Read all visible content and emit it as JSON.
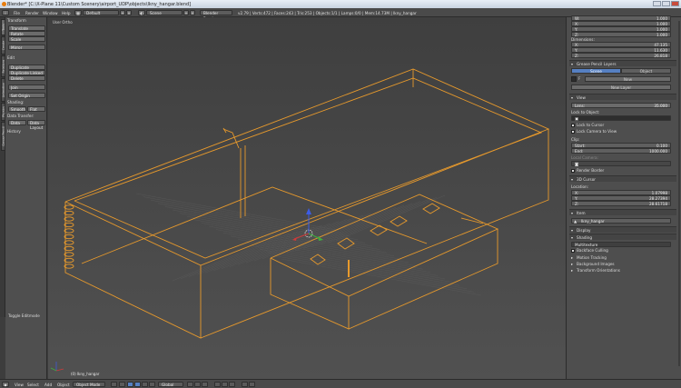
{
  "window": {
    "title": "Blender* [C:\\X-Plane 11\\Custom Scenery\\airport_UDP\\objects\\lkny_hangar.blend]"
  },
  "header": {
    "menu": [
      "File",
      "Render",
      "Window",
      "Help"
    ],
    "layout": "Default",
    "scene": "Scene",
    "engine": "Blender Render",
    "stats": "v2.79 | Verts:472 | Faces:243 | Tris:253 | Objects:1/1 | Lamps:0/0 | Mem:14.73M | lkny_hangar"
  },
  "toolshelf": {
    "tabs": [
      "Tools",
      "Create",
      "Relations",
      "Animation",
      "Physics",
      "Grease Pencil"
    ],
    "transform_title": "Transform",
    "transform_buttons": [
      "Translate",
      "Rotate",
      "Scale",
      "Mirror"
    ],
    "edit_title": "Edit",
    "edit_buttons": [
      "Duplicate",
      "Duplicate Linked",
      "Delete"
    ],
    "join": "Join",
    "set_origin": "Set Origin",
    "shading_title": "Shading:",
    "smooth": "Smooth",
    "flat": "Flat",
    "data_transfer_title": "Data Transfer:",
    "data": "Data",
    "data_layout": "Data Layout",
    "history_title": "History",
    "toggle_edit": "Toggle Editmode"
  },
  "viewport": {
    "view_label": "User Ortho",
    "object_label": "(0) lkny_hangar",
    "wire_color": "#e89a2c",
    "grid_color": "#5a5a5a"
  },
  "properties": {
    "rotation": [
      {
        "k": "W:",
        "v": "1.000"
      },
      {
        "k": "X:",
        "v": "1.000"
      },
      {
        "k": "Y:",
        "v": "1.000"
      },
      {
        "k": "Z:",
        "v": "1.000"
      }
    ],
    "dimensions_title": "Dimensions:",
    "dimensions": [
      {
        "k": "X:",
        "v": "47.135"
      },
      {
        "k": "Y:",
        "v": "11.630"
      },
      {
        "k": "Z:",
        "v": "26.818"
      }
    ],
    "grease_title": "Grease Pencil Layers",
    "grease_tabs": [
      "Scene",
      "Object"
    ],
    "grease_new": "New",
    "grease_new_layer": "New Layer",
    "view_title": "View",
    "lens_label": "Lens:",
    "lens_value": "35.000",
    "lock_object": "Lock to Object:",
    "lock_cursor": "Lock to Cursor",
    "lock_camera": "Lock Camera to View",
    "clip_title": "Clip:",
    "clip": [
      {
        "k": "Start:",
        "v": "0.100"
      },
      {
        "k": "End:",
        "v": "1000.000"
      }
    ],
    "local_camera": "Local Camera:",
    "render_border": "Render Border",
    "cursor_title": "3D Cursor",
    "location_title": "Location:",
    "cursor_loc": [
      {
        "k": "X:",
        "v": "1.07998"
      },
      {
        "k": "Y:",
        "v": "28.27394"
      },
      {
        "k": "Z:",
        "v": "28.61718"
      }
    ],
    "item_title": "Item",
    "item_name": "lkny_hangar",
    "display_title": "Display",
    "shading_title": "Shading",
    "shading_mode": "Multitexture",
    "backface": "Backface Culling",
    "motion_tracking": "Motion Tracking",
    "background_images": "Background Images",
    "transform_orientations": "Transform Orientations"
  },
  "footer": {
    "menu": [
      "View",
      "Select",
      "Add",
      "Object"
    ],
    "mode": "Object Mode",
    "pivot": "Global"
  }
}
